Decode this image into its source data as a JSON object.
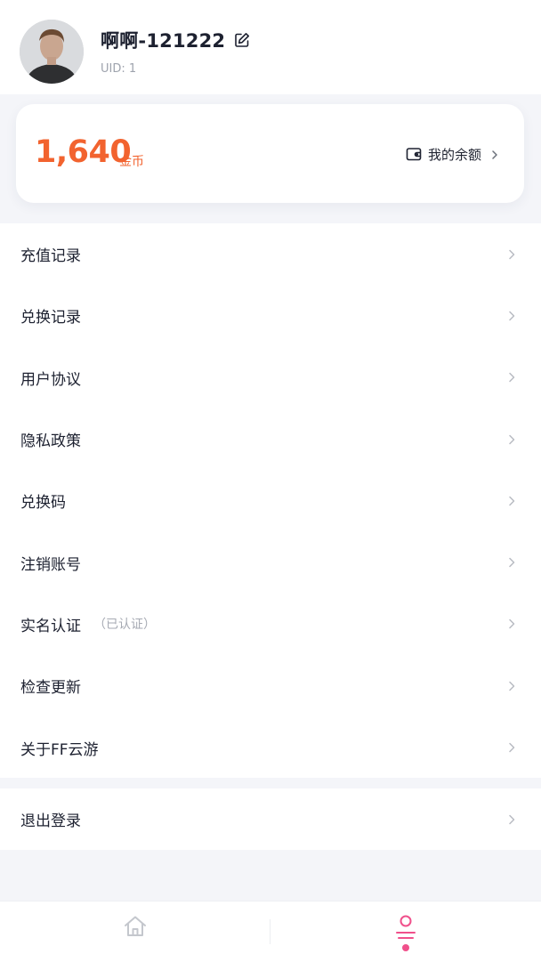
{
  "profile": {
    "username": "啊啊-121222",
    "uid": "UID: 1"
  },
  "balance": {
    "amount": "1,640",
    "unit": "金币",
    "link_label": "我的余额"
  },
  "menu": {
    "items": [
      {
        "label": "充值记录"
      },
      {
        "label": "兑换记录"
      },
      {
        "label": "用户协议"
      },
      {
        "label": "隐私政策"
      },
      {
        "label": "兑换码"
      },
      {
        "label": "注销账号"
      },
      {
        "label": "实名认证",
        "sub": "（已认证）"
      },
      {
        "label": "检查更新"
      },
      {
        "label": "关于FF云游"
      }
    ]
  },
  "logout": {
    "label": "退出登录"
  },
  "tabbar": {
    "tabs": [
      {
        "icon": "home-icon",
        "active": false
      },
      {
        "icon": "user-icon",
        "active": true
      }
    ]
  },
  "colors": {
    "accent": "#f2632f",
    "active_tab": "#f0508b",
    "background": "#f4f5f9"
  }
}
